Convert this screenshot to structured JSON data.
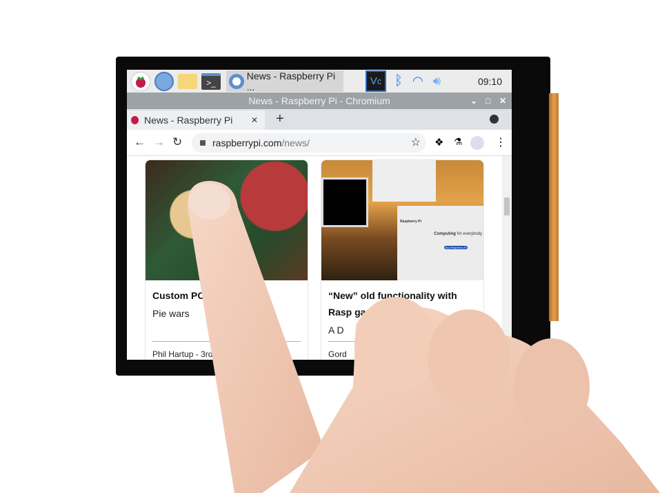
{
  "taskbar": {
    "active_task": "News - Raspberry Pi ...",
    "clock": "09:10",
    "icons": [
      "raspberry-menu-icon",
      "browser-globe-icon",
      "file-manager-icon",
      "terminal-icon",
      "vnc-icon",
      "bluetooth-icon",
      "wifi-icon",
      "volume-icon"
    ]
  },
  "window": {
    "title": "News - Raspberry Pi - Chromium"
  },
  "tabs": [
    {
      "label": "News - Raspberry Pi"
    }
  ],
  "address": {
    "domain": "raspberrypi.com",
    "path": "/news/"
  },
  "cards": [
    {
      "title": "Custom PC Mi",
      "subtitle": "Pie wars",
      "meta": "Phil Hartup - 3rd Dec 20"
    },
    {
      "title": "“New” old functionality with",
      "title2": "Rasp                    gacy)",
      "subtitle": "A D",
      "meta": "Gord"
    }
  ],
  "inner_screenshot": {
    "brand": "Raspberry Pi",
    "headline_bold": "Computing",
    "headline_rest": " for everybody",
    "cta": "Buy Raspberry Pi"
  },
  "colors": {
    "accent_pink": "#f48fb1",
    "titlebar": "#9da2a7",
    "skin": "#f2cdb8"
  }
}
